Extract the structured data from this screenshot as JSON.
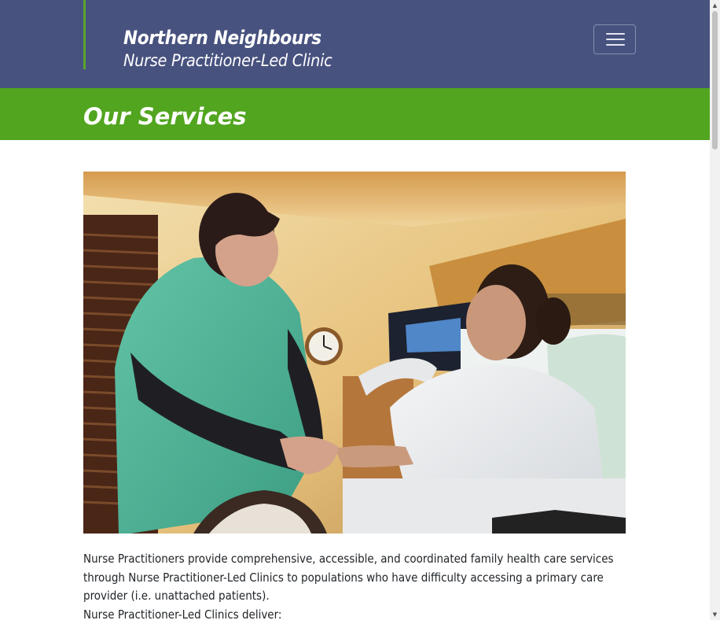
{
  "header": {
    "logo_line1": "Northern Neighbours",
    "logo_line2": "Nurse Practitioner-Led Clinic",
    "menu_toggle_icon": "hamburger-menu-icon",
    "colors": {
      "header_bg": "#48527f",
      "accent_green": "#52a51f"
    }
  },
  "page": {
    "title": "Our Services"
  },
  "hero": {
    "image": "photo-nurse-with-patient"
  },
  "content": {
    "intro": "Nurse Practitioners provide comprehensive, accessible, and coordinated family health care services through Nurse Practitioner-Led Clinics to populations who have difficulty accessing a primary care provider (i.e. unattached patients).",
    "deliver_heading": "Nurse Practitioner-Led Clinics deliver:"
  },
  "scrollbar": {
    "up_icon": "scroll-up-arrow-icon",
    "down_icon": "scroll-down-arrow-icon"
  }
}
